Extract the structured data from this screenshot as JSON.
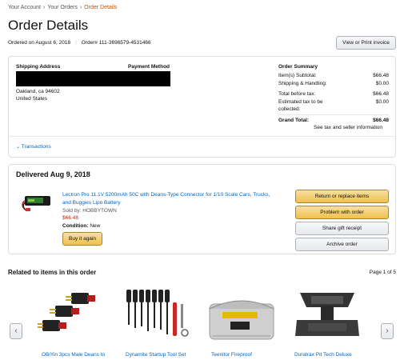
{
  "breadcrumb": {
    "items": [
      "Your Account",
      "Your Orders"
    ],
    "current": "Order Details"
  },
  "page_title": "Order Details",
  "order_meta": {
    "ordered_on": "Ordered on August 6, 2018",
    "order_number": "Order# 111-3696579-4531466"
  },
  "header_button": "View or Print invoice",
  "shipping": {
    "heading": "Shipping Address",
    "line1": "Oakland, ca 94602",
    "line2": "United States"
  },
  "payment": {
    "heading": "Payment Method"
  },
  "summary": {
    "heading": "Order Summary",
    "rows": [
      {
        "label": "Item(s) Subtotal:",
        "value": "$66.48"
      },
      {
        "label": "Shipping & Handling:",
        "value": "$0.00"
      },
      {
        "label": "Total before tax:",
        "value": "$66.48"
      },
      {
        "label": "Estimated tax to be",
        "label2": "collected:",
        "value": "$0.00"
      }
    ],
    "grand_label": "Grand Total:",
    "grand_value": "$66.48",
    "tax_link": "See tax and seller information"
  },
  "transactions_link": "Transactions",
  "shipment": {
    "heading": "Delivered Aug 9, 2018",
    "item_title_line1": "Lectron Pro 11.1V 5200mAh 50C with Deans-Type Connector for 1/10 Scale Cars, Trucks,",
    "item_title_line2": "and Buggies Lipo Battery",
    "sold_by": "Sold by: HOBBYTOWN",
    "price": "$66.48",
    "condition_label": "Condition:",
    "condition_value": "New",
    "buy_again": "Buy it again",
    "actions": [
      "Return or replace items",
      "Problem with order",
      "Share gift receipt",
      "Archive order"
    ]
  },
  "related": {
    "heading": "Related to items in this order",
    "page": "Page 1 of 5",
    "items": [
      {
        "title": "OBiYin 3pcs Male Deans to"
      },
      {
        "title": "Dynamite Startup Tool Set"
      },
      {
        "title": "Teenitor Fireproof"
      },
      {
        "title": "Duratrax Pit Tech Deluxe"
      }
    ],
    "prev": "‹",
    "next": "›"
  },
  "colors": {
    "link": "#0066c0",
    "active_crumb": "#c45500",
    "price": "#b12704",
    "button_yellow": "#f0c14b"
  }
}
